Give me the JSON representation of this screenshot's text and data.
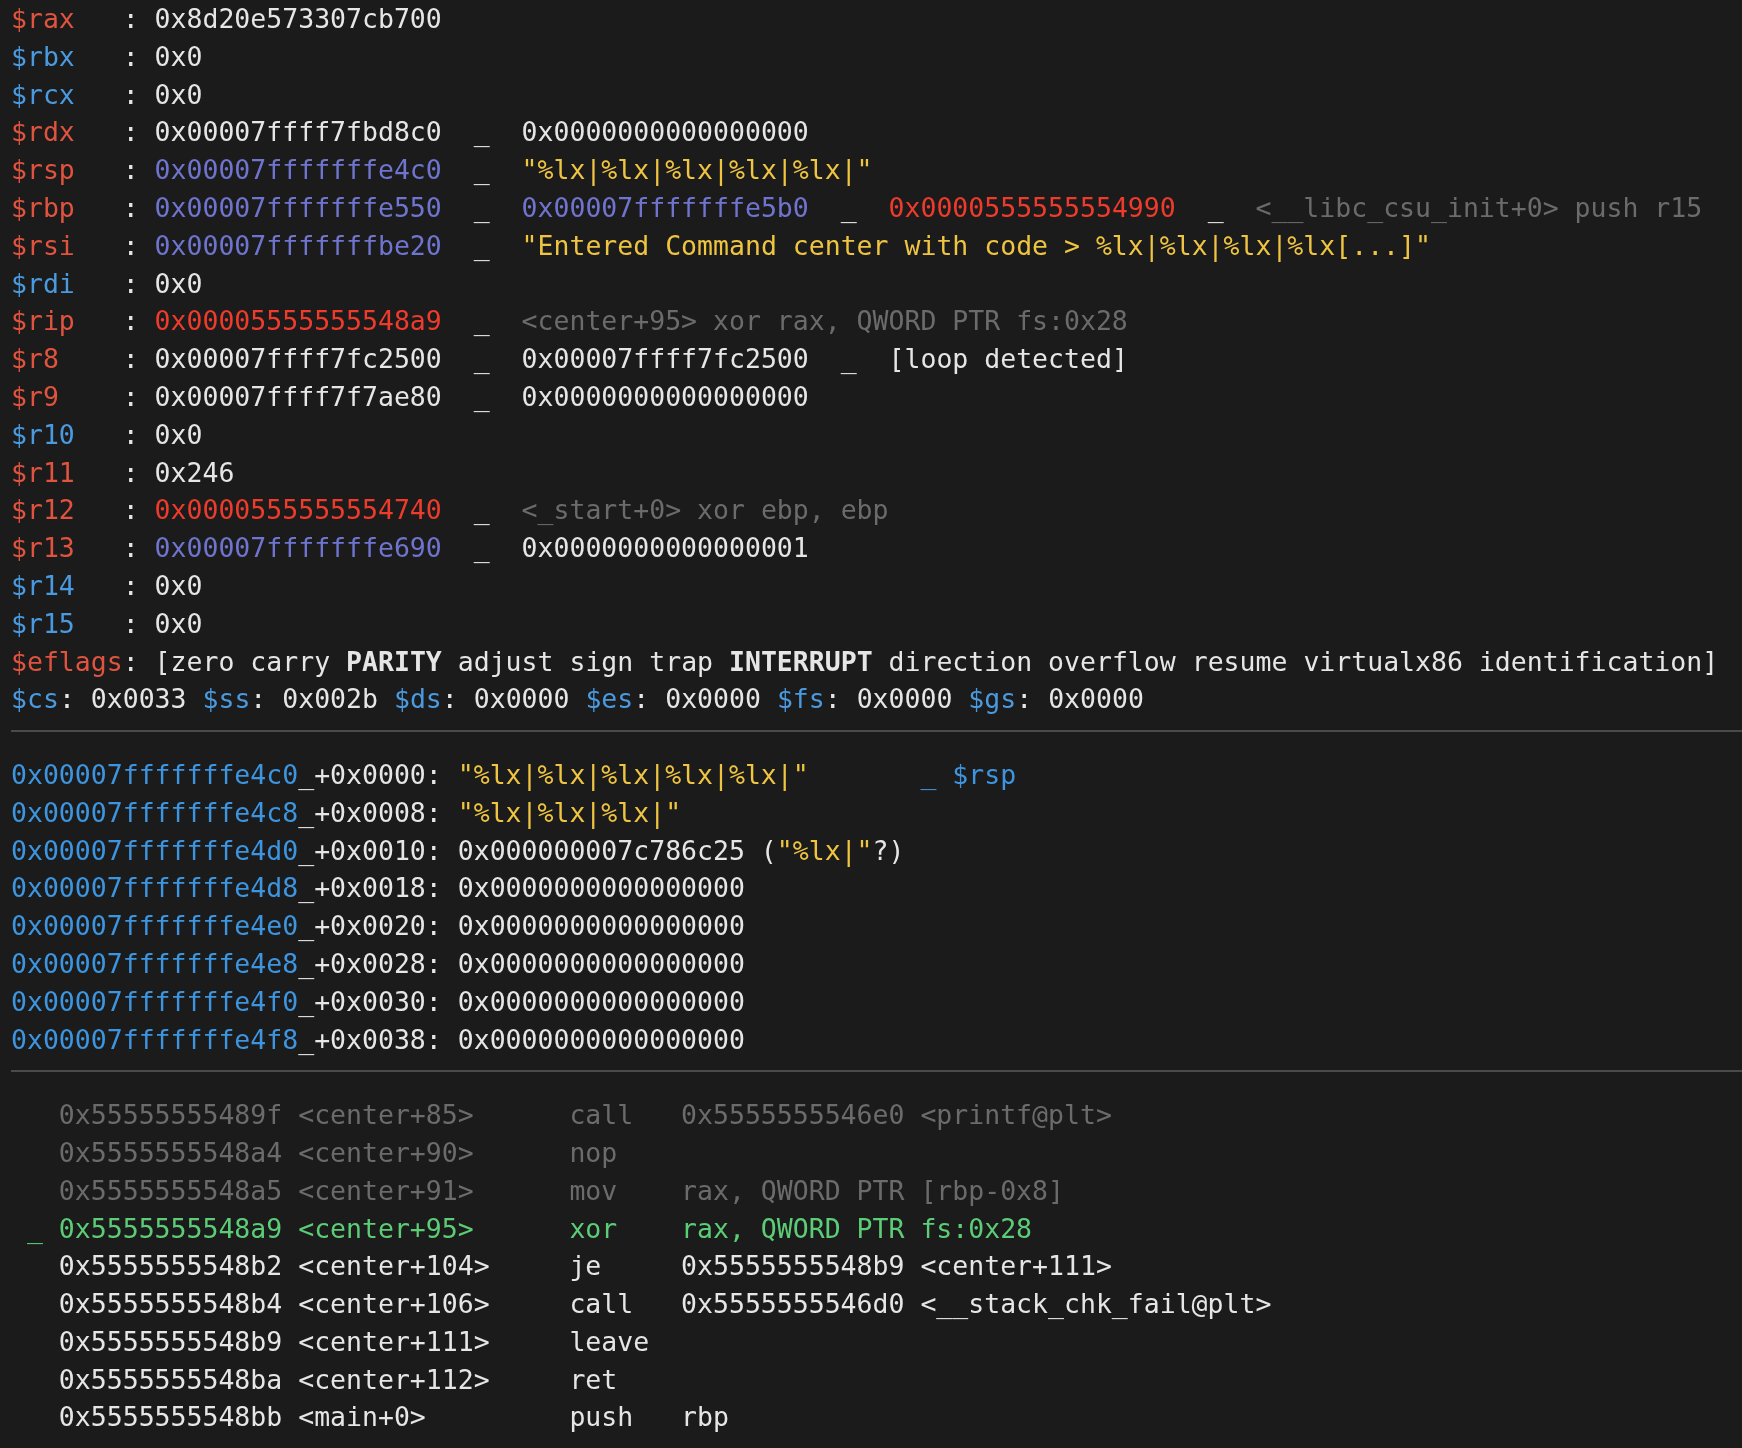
{
  "registers": [
    {
      "name": "$rax",
      "changed": true,
      "sep": ":",
      "chain": [
        {
          "kind": "plain",
          "text": "0x8d20e573307cb700"
        }
      ]
    },
    {
      "name": "$rbx",
      "changed": false,
      "sep": ":",
      "chain": [
        {
          "kind": "plain",
          "text": "0x0"
        }
      ]
    },
    {
      "name": "$rcx",
      "changed": false,
      "sep": ":",
      "chain": [
        {
          "kind": "plain",
          "text": "0x0"
        }
      ]
    },
    {
      "name": "$rdx",
      "changed": true,
      "sep": ":",
      "chain": [
        {
          "kind": "plain",
          "text": "0x00007ffff7fbd8c0"
        },
        {
          "kind": "arrow",
          "text": "_"
        },
        {
          "kind": "plain",
          "text": "0x0000000000000000"
        }
      ]
    },
    {
      "name": "$rsp",
      "changed": true,
      "sep": ":",
      "chain": [
        {
          "kind": "stack",
          "text": "0x00007fffffffe4c0"
        },
        {
          "kind": "arrow",
          "text": "_"
        },
        {
          "kind": "string",
          "text": "\"%lx|%lx|%lx|%lx|%lx|\""
        }
      ]
    },
    {
      "name": "$rbp",
      "changed": true,
      "sep": ":",
      "chain": [
        {
          "kind": "stack",
          "text": "0x00007fffffffe550"
        },
        {
          "kind": "arrow",
          "text": "_"
        },
        {
          "kind": "stack",
          "text": "0x00007fffffffe5b0"
        },
        {
          "kind": "arrow",
          "text": "_"
        },
        {
          "kind": "code",
          "text": "0x0000555555554990"
        },
        {
          "kind": "arrow",
          "text": "_"
        },
        {
          "kind": "comment",
          "text": "<__libc_csu_init+0> push r15"
        }
      ]
    },
    {
      "name": "$rsi",
      "changed": true,
      "sep": ":",
      "chain": [
        {
          "kind": "stack",
          "text": "0x00007fffffffbe20"
        },
        {
          "kind": "arrow",
          "text": "_"
        },
        {
          "kind": "string",
          "text": "\"Entered Command center with code > %lx|%lx|%lx|%lx[...]\""
        }
      ]
    },
    {
      "name": "$rdi",
      "changed": false,
      "sep": ":",
      "chain": [
        {
          "kind": "plain",
          "text": "0x0"
        }
      ]
    },
    {
      "name": "$rip",
      "changed": true,
      "sep": ":",
      "chain": [
        {
          "kind": "code",
          "text": "0x00005555555548a9"
        },
        {
          "kind": "arrow",
          "text": "_"
        },
        {
          "kind": "comment",
          "text": "<center+95> xor rax, QWORD PTR fs:0x28"
        }
      ]
    },
    {
      "name": "$r8",
      "changed": true,
      "sep": ":",
      "chain": [
        {
          "kind": "plain",
          "text": "0x00007ffff7fc2500"
        },
        {
          "kind": "arrow",
          "text": "_"
        },
        {
          "kind": "plain",
          "text": "0x00007ffff7fc2500"
        },
        {
          "kind": "arrow",
          "text": "_"
        },
        {
          "kind": "plain",
          "text": "[loop detected]"
        }
      ]
    },
    {
      "name": "$r9",
      "changed": true,
      "sep": ":",
      "chain": [
        {
          "kind": "plain",
          "text": "0x00007ffff7f7ae80"
        },
        {
          "kind": "arrow",
          "text": "_"
        },
        {
          "kind": "plain",
          "text": "0x0000000000000000"
        }
      ]
    },
    {
      "name": "$r10",
      "changed": false,
      "sep": ":",
      "chain": [
        {
          "kind": "plain",
          "text": "0x0"
        }
      ]
    },
    {
      "name": "$r11",
      "changed": true,
      "sep": ":",
      "chain": [
        {
          "kind": "plain",
          "text": "0x246"
        }
      ]
    },
    {
      "name": "$r12",
      "changed": true,
      "sep": ":",
      "chain": [
        {
          "kind": "code",
          "text": "0x0000555555554740"
        },
        {
          "kind": "arrow",
          "text": "_"
        },
        {
          "kind": "comment",
          "text": "<_start+0> xor ebp, ebp"
        }
      ]
    },
    {
      "name": "$r13",
      "changed": true,
      "sep": ":",
      "chain": [
        {
          "kind": "stack",
          "text": "0x00007fffffffe690"
        },
        {
          "kind": "arrow",
          "text": "_"
        },
        {
          "kind": "plain",
          "text": "0x0000000000000001"
        }
      ]
    },
    {
      "name": "$r14",
      "changed": false,
      "sep": ":",
      "chain": [
        {
          "kind": "plain",
          "text": "0x0"
        }
      ]
    },
    {
      "name": "$r15",
      "changed": false,
      "sep": ":",
      "chain": [
        {
          "kind": "plain",
          "text": "0x0"
        }
      ]
    }
  ],
  "eflags": {
    "name": "$eflags",
    "changed": true,
    "sep": ":",
    "flags": [
      {
        "text": "[zero",
        "set": false
      },
      {
        "text": "carry",
        "set": false
      },
      {
        "text": "PARITY",
        "set": true
      },
      {
        "text": "adjust",
        "set": false
      },
      {
        "text": "sign",
        "set": false
      },
      {
        "text": "trap",
        "set": false
      },
      {
        "text": "INTERRUPT",
        "set": true
      },
      {
        "text": "direction",
        "set": false
      },
      {
        "text": "overflow",
        "set": false
      },
      {
        "text": "resume",
        "set": false
      },
      {
        "text": "virtualx86",
        "set": false
      },
      {
        "text": "identification]",
        "set": false
      }
    ]
  },
  "segments": [
    {
      "name": "$cs",
      "value": ": 0x0033"
    },
    {
      "name": "$ss",
      "value": ": 0x002b"
    },
    {
      "name": "$ds",
      "value": ": 0x0000"
    },
    {
      "name": "$es",
      "value": ": 0x0000"
    },
    {
      "name": "$fs",
      "value": ": 0x0000"
    },
    {
      "name": "$gs",
      "value": ": 0x0000"
    }
  ],
  "stack": [
    {
      "address": "0x00007fffffffe4c0",
      "offset": "_+0x0000:",
      "value": [
        {
          "kind": "string",
          "text": "\"%lx|%lx|%lx|%lx|%lx|\""
        }
      ],
      "comment": "_ $rsp"
    },
    {
      "address": "0x00007fffffffe4c8",
      "offset": "_+0x0008:",
      "value": [
        {
          "kind": "string",
          "text": "\"%lx|%lx|%lx|\""
        }
      ]
    },
    {
      "address": "0x00007fffffffe4d0",
      "offset": "_+0x0010:",
      "value": [
        {
          "kind": "plain",
          "text": "0x000000007c786c25 ("
        },
        {
          "kind": "string",
          "text": "\"%lx|\""
        },
        {
          "kind": "plain",
          "text": "?)"
        }
      ]
    },
    {
      "address": "0x00007fffffffe4d8",
      "offset": "_+0x0018:",
      "value": [
        {
          "kind": "plain",
          "text": "0x0000000000000000"
        }
      ]
    },
    {
      "address": "0x00007fffffffe4e0",
      "offset": "_+0x0020:",
      "value": [
        {
          "kind": "plain",
          "text": "0x0000000000000000"
        }
      ]
    },
    {
      "address": "0x00007fffffffe4e8",
      "offset": "_+0x0028:",
      "value": [
        {
          "kind": "plain",
          "text": "0x0000000000000000"
        }
      ]
    },
    {
      "address": "0x00007fffffffe4f0",
      "offset": "_+0x0030:",
      "value": [
        {
          "kind": "plain",
          "text": "0x0000000000000000"
        }
      ]
    },
    {
      "address": "0x00007fffffffe4f8",
      "offset": "_+0x0038:",
      "value": [
        {
          "kind": "plain",
          "text": "0x0000000000000000"
        }
      ]
    }
  ],
  "code": [
    {
      "kind": "past",
      "address": "0x55555555489f",
      "symbol": "<center+85>",
      "mnemonic": "call",
      "operands": "0x5555555546e0 <printf@plt>"
    },
    {
      "kind": "past",
      "address": "0x5555555548a4",
      "symbol": "<center+90>",
      "mnemonic": "nop"
    },
    {
      "kind": "past",
      "address": "0x5555555548a5",
      "symbol": "<center+91>",
      "mnemonic": "mov",
      "operands": "rax, QWORD PTR [rbp-0x8]"
    },
    {
      "kind": "current",
      "marker": "_",
      "address": "0x5555555548a9",
      "symbol": "<center+95>",
      "mnemonic": "xor",
      "operands": "rax, QWORD PTR fs:0x28"
    },
    {
      "kind": "next",
      "address": "0x5555555548b2",
      "symbol": "<center+104>",
      "mnemonic": "je",
      "operands": "0x5555555548b9 <center+111>"
    },
    {
      "kind": "next",
      "address": "0x5555555548b4",
      "symbol": "<center+106>",
      "mnemonic": "call",
      "operands": "0x5555555546d0 <__stack_chk_fail@plt>"
    },
    {
      "kind": "next",
      "address": "0x5555555548b9",
      "symbol": "<center+111>",
      "mnemonic": "leave"
    },
    {
      "kind": "next",
      "address": "0x5555555548ba",
      "symbol": "<center+112>",
      "mnemonic": "ret"
    },
    {
      "kind": "next",
      "address": "0x5555555548bb",
      "symbol": "<main+0>",
      "mnemonic": "push",
      "operands": "rbp"
    }
  ]
}
